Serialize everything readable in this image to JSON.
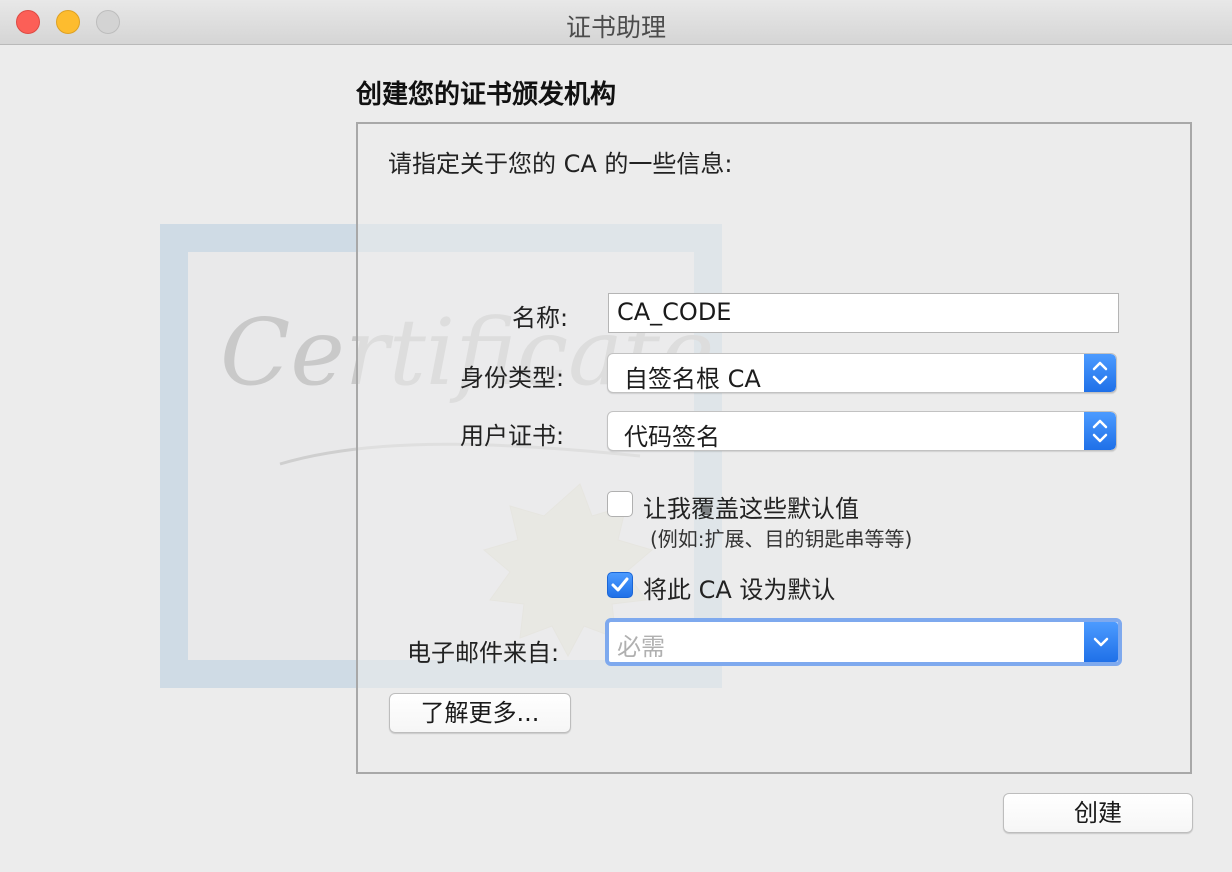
{
  "window": {
    "title": "证书助理"
  },
  "heading": "创建您的证书颁发机构",
  "intro": "请指定关于您的 CA 的一些信息:",
  "form": {
    "name_label": "名称:",
    "name_value": "CA_CODE",
    "identity_label": "身份类型:",
    "identity_value": "自签名根 CA",
    "user_cert_label": "用户证书:",
    "user_cert_value": "代码签名",
    "override_label": "让我覆盖这些默认值",
    "override_hint": "(例如:扩展、目的钥匙串等等)",
    "override_checked": false,
    "default_ca_label": "将此 CA 设为默认",
    "default_ca_checked": true,
    "email_label": "电子邮件来自:",
    "email_placeholder": "必需"
  },
  "buttons": {
    "learn_more": "了解更多...",
    "create": "创建"
  },
  "background": {
    "certificate_script": "Certificate"
  },
  "colors": {
    "accent": "#2a7ef5",
    "close": "#fc5f57",
    "minimize": "#fdbc2e",
    "zoom": "#d3d3d3"
  }
}
